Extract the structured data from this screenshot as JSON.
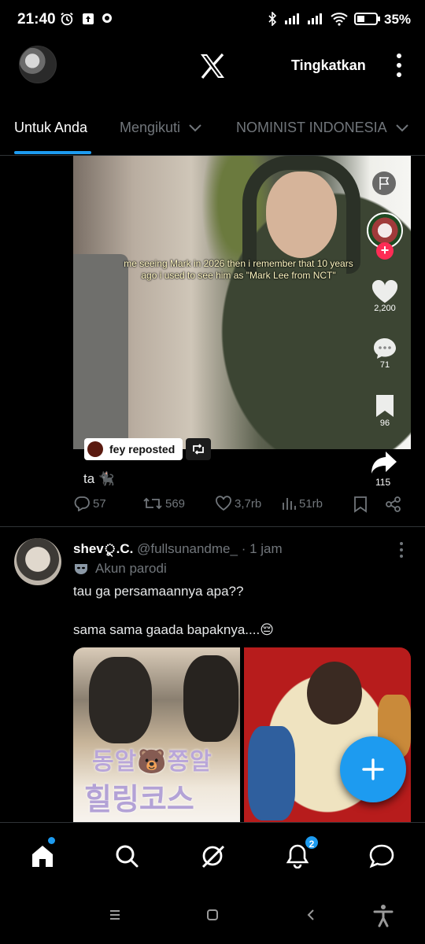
{
  "status_bar": {
    "time": "21:40",
    "battery_percent": "35%",
    "icons": [
      "alarm-icon",
      "upload-icon",
      "chat-bubble-icon",
      "bluetooth-icon",
      "signal-icon",
      "signal-icon",
      "wifi-icon",
      "battery-icon"
    ]
  },
  "header": {
    "logo": "X",
    "upgrade_label": "Tingkatkan",
    "menu_icon": "more-vertical-icon"
  },
  "tabs": [
    {
      "label": "Untuk Anda",
      "active": true
    },
    {
      "label": "Mengikuti",
      "active": false,
      "dropdown": true
    },
    {
      "label": "NOMINIST INDONESIA",
      "active": false,
      "dropdown": true
    }
  ],
  "post1": {
    "video_caption": "me seeing Mark in 2026 then i remember that 10 years ago i used to see him as \"Mark Lee from NCT\"",
    "video_likes": "2,200",
    "video_comments": "71",
    "video_saves": "96",
    "video_shares": "115",
    "repost_chip": "fey reposted",
    "text": "ta 🐈‍⬛",
    "replies": "57",
    "reposts": "569",
    "likes": "3,7rb",
    "views": "51rb"
  },
  "post2": {
    "name": "shev",
    "name_suffix": "ু.C.",
    "handle": "@fullsunandme_",
    "time": "· 1 jam",
    "parody_label": "Akun parodi",
    "text1": "tau ga persamaannya apa??",
    "text2": "sama sama gaada bapaknya....😔",
    "media1_title_line1": "동알🐻쫑알",
    "media1_title_line2": "힐링코스"
  },
  "bottom_nav": {
    "items": [
      "home-icon",
      "search-icon",
      "grok-icon",
      "notifications-icon",
      "messages-icon"
    ],
    "notification_badge": "2"
  },
  "colors": {
    "accent": "#1d9bf0",
    "background": "#000000",
    "muted_text": "#71767b",
    "divider": "#2f3336"
  }
}
